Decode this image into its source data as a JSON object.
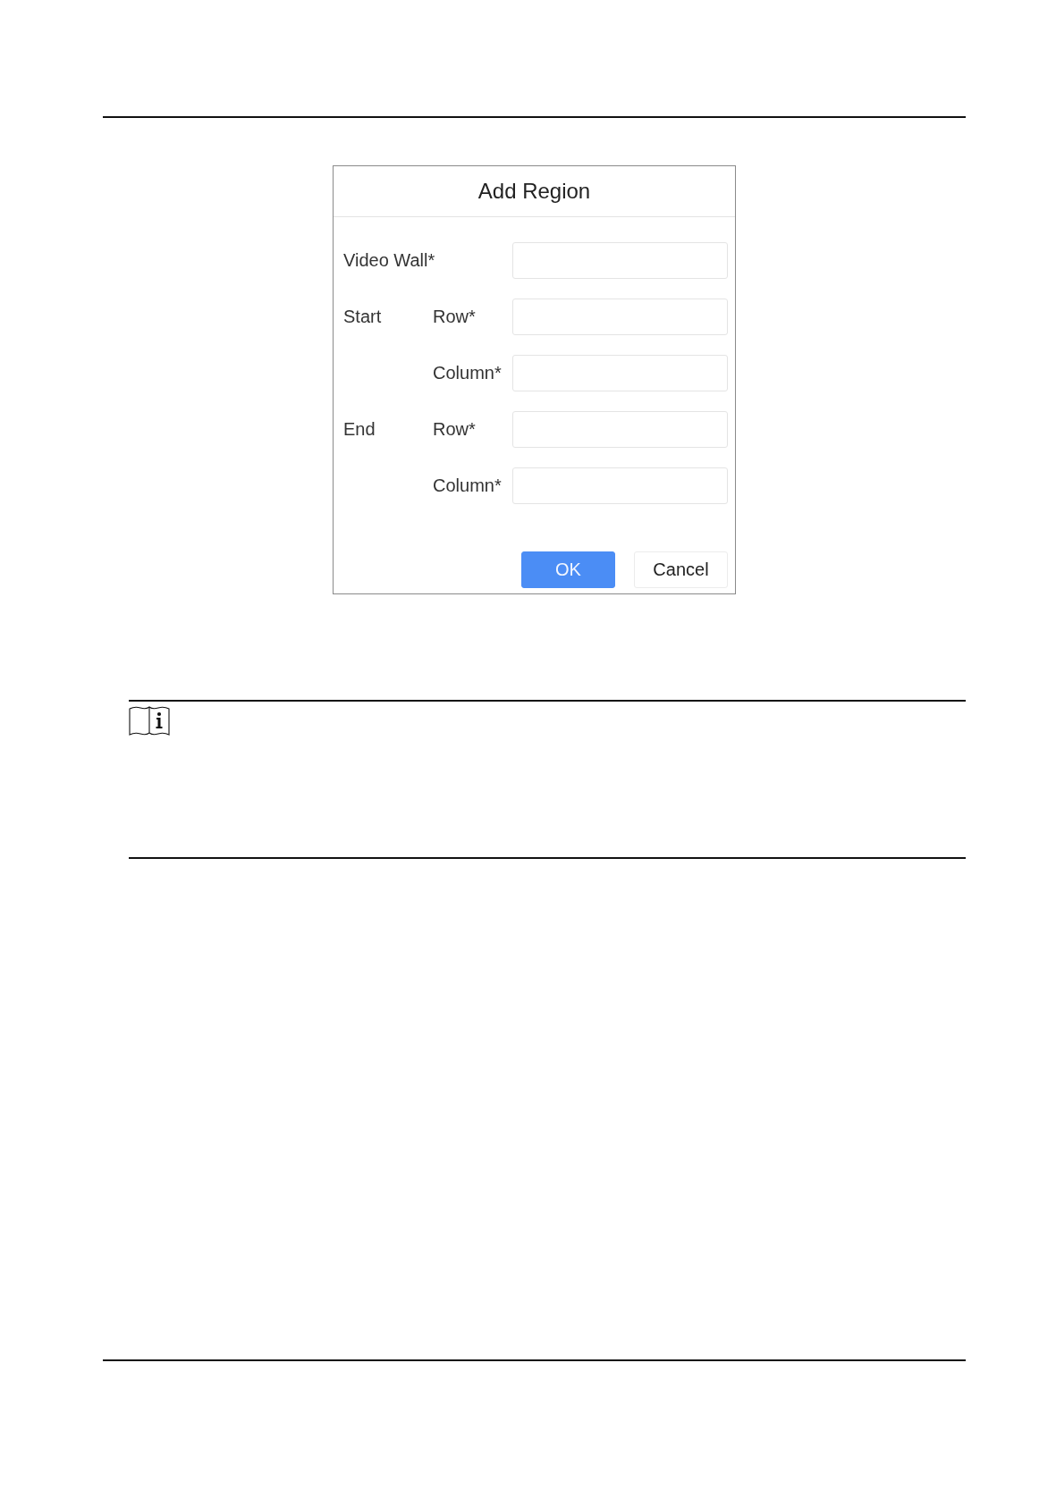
{
  "dialog": {
    "title": "Add Region",
    "form": [
      {
        "kind": "field",
        "label": "Video Wall*"
      },
      {
        "kind": "group",
        "label": "Start",
        "fields": [
          {
            "label": "Row*"
          },
          {
            "label": "Column*"
          }
        ]
      },
      {
        "kind": "group",
        "label": "End",
        "fields": [
          {
            "label": "Row*"
          },
          {
            "label": "Column*"
          }
        ]
      }
    ],
    "buttons": [
      {
        "label": "OK",
        "kind": "primary"
      },
      {
        "label": "Cancel",
        "kind": "secondary"
      }
    ]
  }
}
